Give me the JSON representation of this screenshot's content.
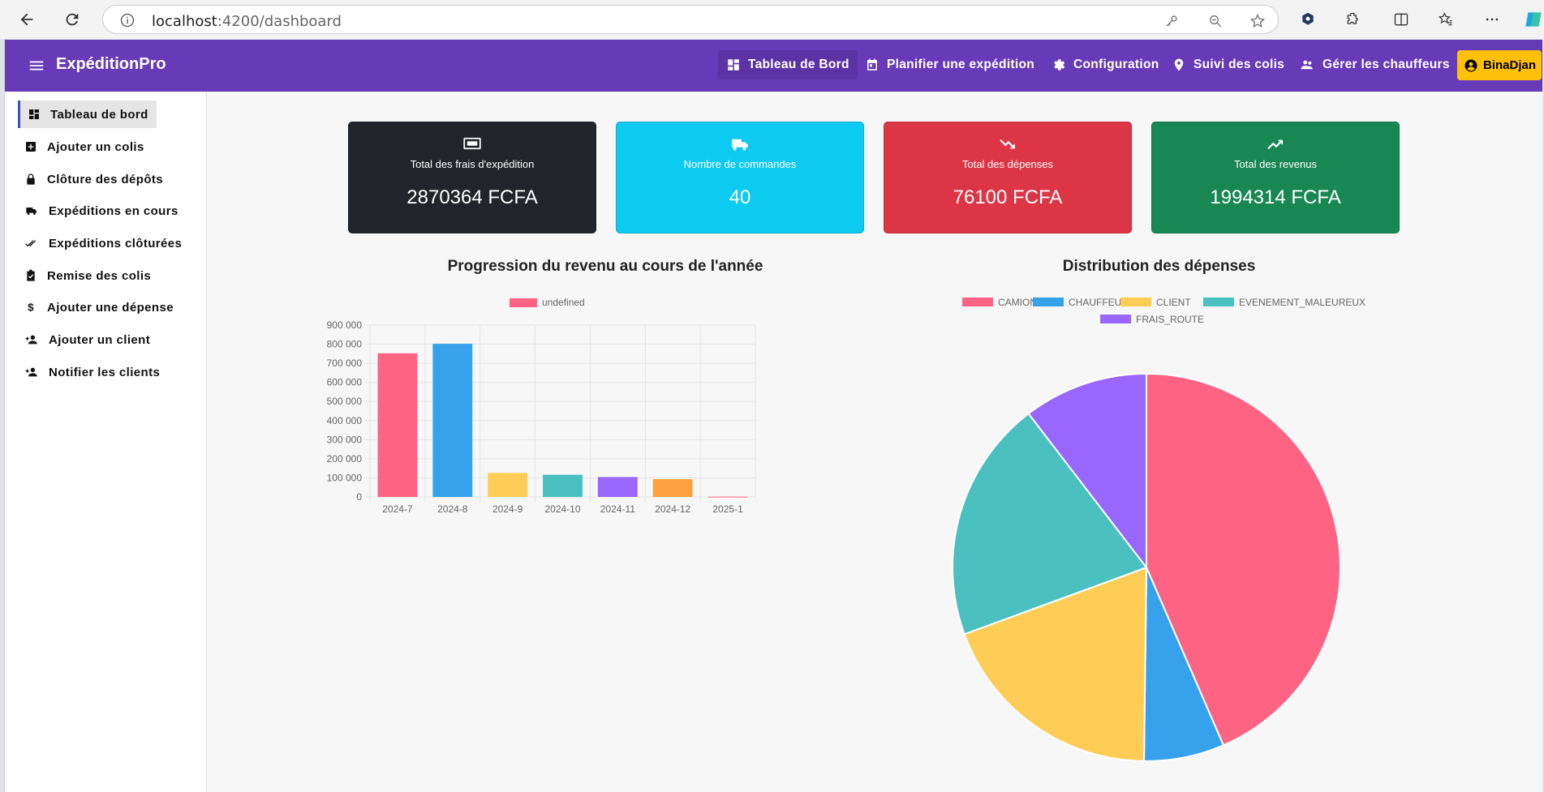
{
  "browser": {
    "url_host": "localhost",
    "url_path": ":4200/dashboard"
  },
  "header": {
    "brand": "ExpéditionPro",
    "nav": [
      {
        "label": "Tableau de Bord",
        "icon": "dashboard-icon"
      },
      {
        "label": "Planifier une expédition",
        "icon": "calendar-icon"
      },
      {
        "label": "Configuration",
        "icon": "gear-icon"
      },
      {
        "label": "Suivi des colis",
        "icon": "location-pin-icon"
      },
      {
        "label": "Gérer les chauffeurs",
        "icon": "people-icon"
      }
    ],
    "user": "BinaDjan"
  },
  "sidebar": {
    "items": [
      {
        "label": "Tableau de bord",
        "icon": "dashboard-icon"
      },
      {
        "label": "Ajouter un colis",
        "icon": "add-box-icon"
      },
      {
        "label": "Clôture des dépôts",
        "icon": "lock-icon"
      },
      {
        "label": "Expéditions en cours",
        "icon": "truck-icon"
      },
      {
        "label": "Expéditions clôturées",
        "icon": "double-check-icon"
      },
      {
        "label": "Remise des colis",
        "icon": "clipboard-check-icon"
      },
      {
        "label": "Ajouter une dépense",
        "icon": "dollar-icon"
      },
      {
        "label": "Ajouter un client",
        "icon": "add-person-icon"
      },
      {
        "label": "Notifier les clients",
        "icon": "add-person-icon"
      }
    ]
  },
  "cards": [
    {
      "title": "Total des frais d'expédition",
      "value": "2870364 FCFA",
      "color": "#212529",
      "icon": "money-icon"
    },
    {
      "title": "Nombre de commandes",
      "value": "40",
      "color": "#0dcaf0",
      "icon": "truck-icon"
    },
    {
      "title": "Total des dépenses",
      "value": "76100 FCFA",
      "color": "#dc3545",
      "icon": "trending-down-icon"
    },
    {
      "title": "Total des revenus",
      "value": "1994314 FCFA",
      "color": "#198754",
      "icon": "trending-up-icon"
    }
  ],
  "charts": {
    "bar_title": "Progression du revenu au cours de l'année",
    "pie_title": "Distribution des dépenses"
  },
  "chart_data": [
    {
      "type": "bar",
      "legend": [
        "undefined"
      ],
      "categories": [
        "2024-7",
        "2024-8",
        "2024-9",
        "2024-10",
        "2024-11",
        "2024-12",
        "2025-1"
      ],
      "values": [
        752000,
        802000,
        126000,
        116000,
        104000,
        93000,
        1500
      ],
      "colors": [
        "#ff6384",
        "#36a2eb",
        "#ffcd56",
        "#4bc0c0",
        "#9966ff",
        "#ff9f40",
        "#ff6384"
      ],
      "ylim": [
        0,
        900000
      ],
      "yticks": [
        "0",
        "100 000",
        "200 000",
        "300 000",
        "400 000",
        "500 000",
        "600 000",
        "700 000",
        "800 000",
        "900 000"
      ],
      "grid": true,
      "legend_position": "top"
    },
    {
      "type": "pie",
      "labels": [
        "CAMION",
        "CHAUFFEUR",
        "CLIENT",
        "EVENEMENT_MALEUREUX",
        "FRAIS_ROUTE"
      ],
      "values": [
        43.5,
        6.7,
        19.2,
        20.2,
        10.4
      ],
      "colors": [
        "#ff6384",
        "#36a2eb",
        "#ffcd56",
        "#4bc0c0",
        "#9966ff"
      ],
      "legend_position": "top"
    }
  ]
}
